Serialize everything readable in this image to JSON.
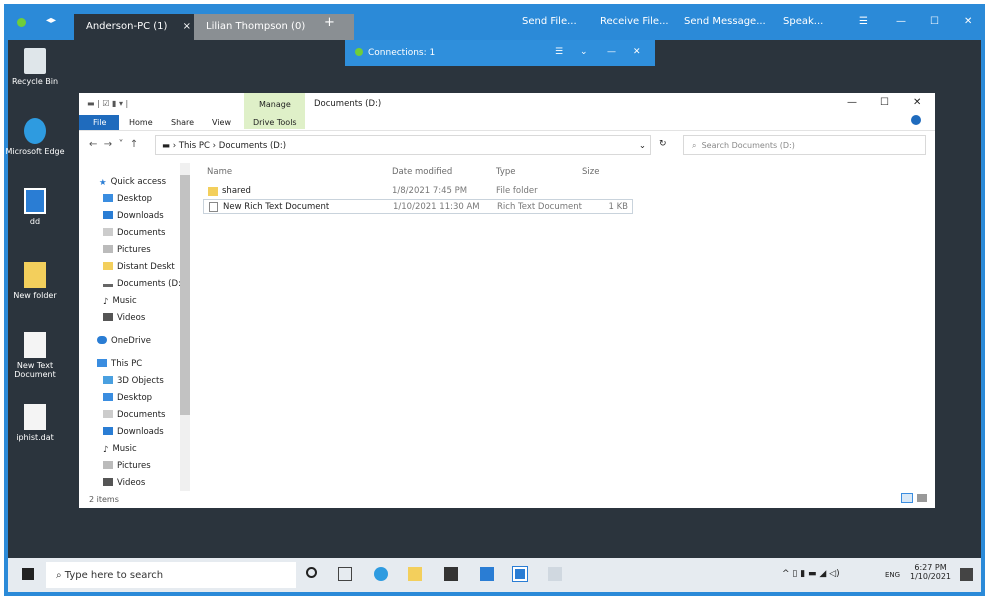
{
  "remote_app": {
    "tabs": [
      {
        "label": "Anderson-PC (1)",
        "close": "×"
      },
      {
        "label": "Lilian Thompson (0)"
      }
    ],
    "new_tab": "+",
    "menu": [
      "Send File...",
      "Receive File...",
      "Send Message...",
      "Speak..."
    ],
    "window_controls": [
      "☰",
      "—",
      "☐",
      "✕"
    ],
    "connections": "Connections: 1",
    "conn_controls": [
      "☰",
      "⌄",
      "—",
      "✕"
    ]
  },
  "desktop_icons": [
    "Recycle Bin",
    "Microsoft Edge",
    "dd",
    "New folder",
    "New Text Document",
    "iphist.dat"
  ],
  "explorer": {
    "title": "Documents (D:)",
    "manage": "Manage",
    "ribbon_tabs": [
      "File",
      "Home",
      "Share",
      "View",
      "Drive Tools"
    ],
    "breadcrumb": [
      "This PC",
      "Documents (D:)"
    ],
    "search_placeholder": "Search Documents (D:)",
    "controls": [
      "—",
      "☐",
      "✕"
    ],
    "nav": [
      "Quick access",
      "Desktop",
      "Downloads",
      "Documents",
      "Pictures",
      "Distant Deskt",
      "Documents (D:)",
      "Music",
      "Videos",
      "OneDrive",
      "This PC",
      "3D Objects",
      "Desktop",
      "Documents",
      "Downloads",
      "Music",
      "Pictures",
      "Videos"
    ],
    "columns": [
      "Name",
      "Date modified",
      "Type",
      "Size"
    ],
    "files": [
      {
        "name": "shared",
        "date": "1/8/2021 7:45 PM",
        "type": "File folder",
        "size": ""
      },
      {
        "name": "New Rich Text Document",
        "date": "1/10/2021 11:30 AM",
        "type": "Rich Text Document",
        "size": "1 KB"
      }
    ],
    "status": "2 items"
  },
  "taskbar": {
    "search_placeholder": "Type here to search",
    "lang": "ENG",
    "time": "6:27 PM",
    "date": "1/10/2021"
  }
}
